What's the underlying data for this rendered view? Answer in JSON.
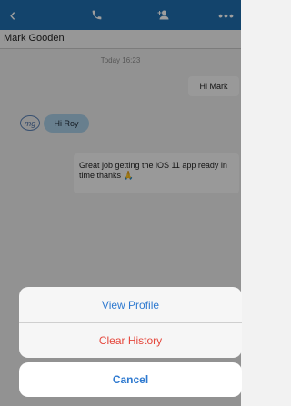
{
  "header": {
    "back_icon": "chevron-left-icon",
    "call_icon": "phone-icon",
    "add_contact_icon": "add-user-icon",
    "more_icon": "more-horizontal-icon",
    "accent": "#1f6fae"
  },
  "contact": {
    "name": "Mark Gooden"
  },
  "chat": {
    "timestamp": "Today 16:23",
    "messages": [
      {
        "direction": "out",
        "text": "Hi Mark"
      },
      {
        "direction": "in",
        "avatar_initials": "mg",
        "text": "Hi Roy"
      },
      {
        "direction": "out",
        "text": "Great job getting the iOS 11 app ready in time thanks 🙏"
      }
    ]
  },
  "action_sheet": {
    "view_profile": "View Profile",
    "clear_history": "Clear History",
    "cancel": "Cancel",
    "colors": {
      "default": "#2f7ad0",
      "destructive": "#e5473c"
    }
  }
}
